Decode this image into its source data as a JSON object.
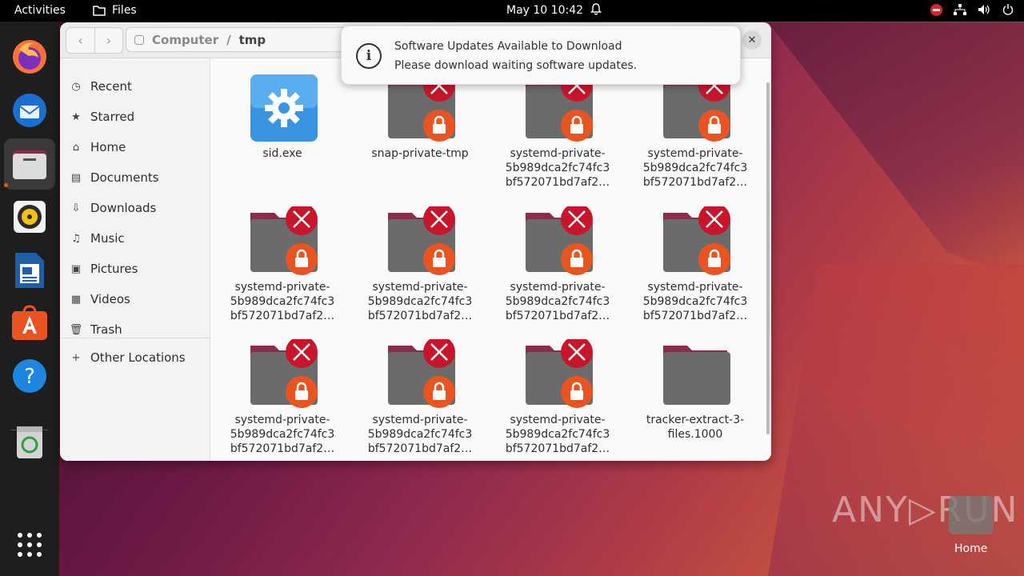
{
  "topbar": {
    "activities": "Activities",
    "app_name": "Files",
    "clock": "May 10  10:42"
  },
  "dock": {
    "items": [
      "firefox-icon",
      "thunderbird-icon",
      "files-icon",
      "rhythmbox-icon",
      "libreoffice-writer-icon",
      "app-center-icon",
      "help-icon",
      "trash-icon",
      "show-apps-icon"
    ]
  },
  "window": {
    "path": {
      "root": "Computer",
      "sep": "/",
      "current": "tmp"
    },
    "sidebar": {
      "items": [
        {
          "label": "Recent",
          "icon": "clock-icon"
        },
        {
          "label": "Starred",
          "icon": "star-icon"
        },
        {
          "label": "Home",
          "icon": "home-icon"
        },
        {
          "label": "Documents",
          "icon": "document-icon"
        },
        {
          "label": "Downloads",
          "icon": "download-icon"
        },
        {
          "label": "Music",
          "icon": "music-icon"
        },
        {
          "label": "Pictures",
          "icon": "picture-icon"
        },
        {
          "label": "Videos",
          "icon": "video-icon"
        },
        {
          "label": "Trash",
          "icon": "trash-icon"
        }
      ],
      "other": {
        "label": "Other Locations",
        "icon": "plus-icon"
      }
    },
    "files": [
      {
        "name": "sid.exe",
        "type": "exe"
      },
      {
        "name": "snap-private-tmp",
        "type": "locked"
      },
      {
        "name": "systemd-private-\n5b989dca2fc74fc3\nbf572071bd7af2…",
        "type": "locked"
      },
      {
        "name": "systemd-private-\n5b989dca2fc74fc3\nbf572071bd7af2…",
        "type": "locked"
      },
      {
        "name": "systemd-private-\n5b989dca2fc74fc3\nbf572071bd7af2…",
        "type": "locked"
      },
      {
        "name": "systemd-private-\n5b989dca2fc74fc3\nbf572071bd7af2…",
        "type": "locked"
      },
      {
        "name": "systemd-private-\n5b989dca2fc74fc3\nbf572071bd7af2…",
        "type": "locked"
      },
      {
        "name": "systemd-private-\n5b989dca2fc74fc3\nbf572071bd7af2…",
        "type": "locked"
      },
      {
        "name": "systemd-private-\n5b989dca2fc74fc3\nbf572071bd7af2…",
        "type": "locked"
      },
      {
        "name": "systemd-private-\n5b989dca2fc74fc3\nbf572071bd7af2…",
        "type": "locked"
      },
      {
        "name": "systemd-private-\n5b989dca2fc74fc3\nbf572071bd7af2…",
        "type": "locked"
      },
      {
        "name": "tracker-extract-3-\nfiles.1000",
        "type": "folder"
      }
    ]
  },
  "notification": {
    "title": "Software Updates Available to Download",
    "body": "Please download waiting software updates."
  },
  "desktop": {
    "watermark": "ANY▷RUN",
    "home_label": "Home"
  },
  "colors": {
    "accent": "#e95420",
    "badge_red": "#c7162b",
    "folder": "#6a6a6a",
    "folder_tab": "#8e2a4e"
  }
}
